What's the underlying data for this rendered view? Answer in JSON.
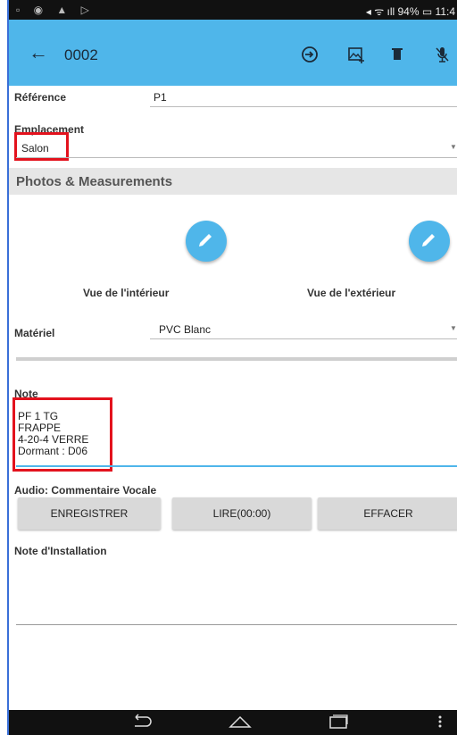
{
  "status": {
    "left_icons": "▫ ◉ ▲ ▷",
    "right": "◂ ᯤ ıll 94% ▭ 11:4"
  },
  "appbar": {
    "back_glyph": "←",
    "title": "0002"
  },
  "form": {
    "reference_label": "Référence",
    "reference_value": "P1",
    "emplacement_label": "Emplacement",
    "emplacement_value": "Salon",
    "section_title": "Photos & Measurements",
    "photo_interior_caption": "Vue de l'intérieur",
    "photo_exterior_caption": "Vue de l'extérieur",
    "materiel_label": "Matériel",
    "materiel_value": "PVC Blanc",
    "note_label": "Note",
    "note_lines": [
      "PF 1 TG",
      "FRAPPE",
      "4-20-4 VERRE",
      "Dormant : D06"
    ],
    "audio_label": "Audio: Commentaire Vocale",
    "buttons": {
      "record": "ENREGISTRER",
      "play": "LIRE(00:00)",
      "erase": "EFFACER"
    },
    "install_note_label": "Note d'Installation"
  },
  "colors": {
    "accent": "#4fb6ea",
    "highlight": "#e3121d"
  },
  "icons": [
    "back-arrow-icon",
    "forward-circle-icon",
    "add-photo-icon",
    "trash-icon",
    "microphone-off-icon",
    "pencil-icon",
    "dropdown-caret-icon",
    "nav-back-icon",
    "nav-home-icon",
    "nav-recents-icon",
    "overflow-menu-icon"
  ]
}
